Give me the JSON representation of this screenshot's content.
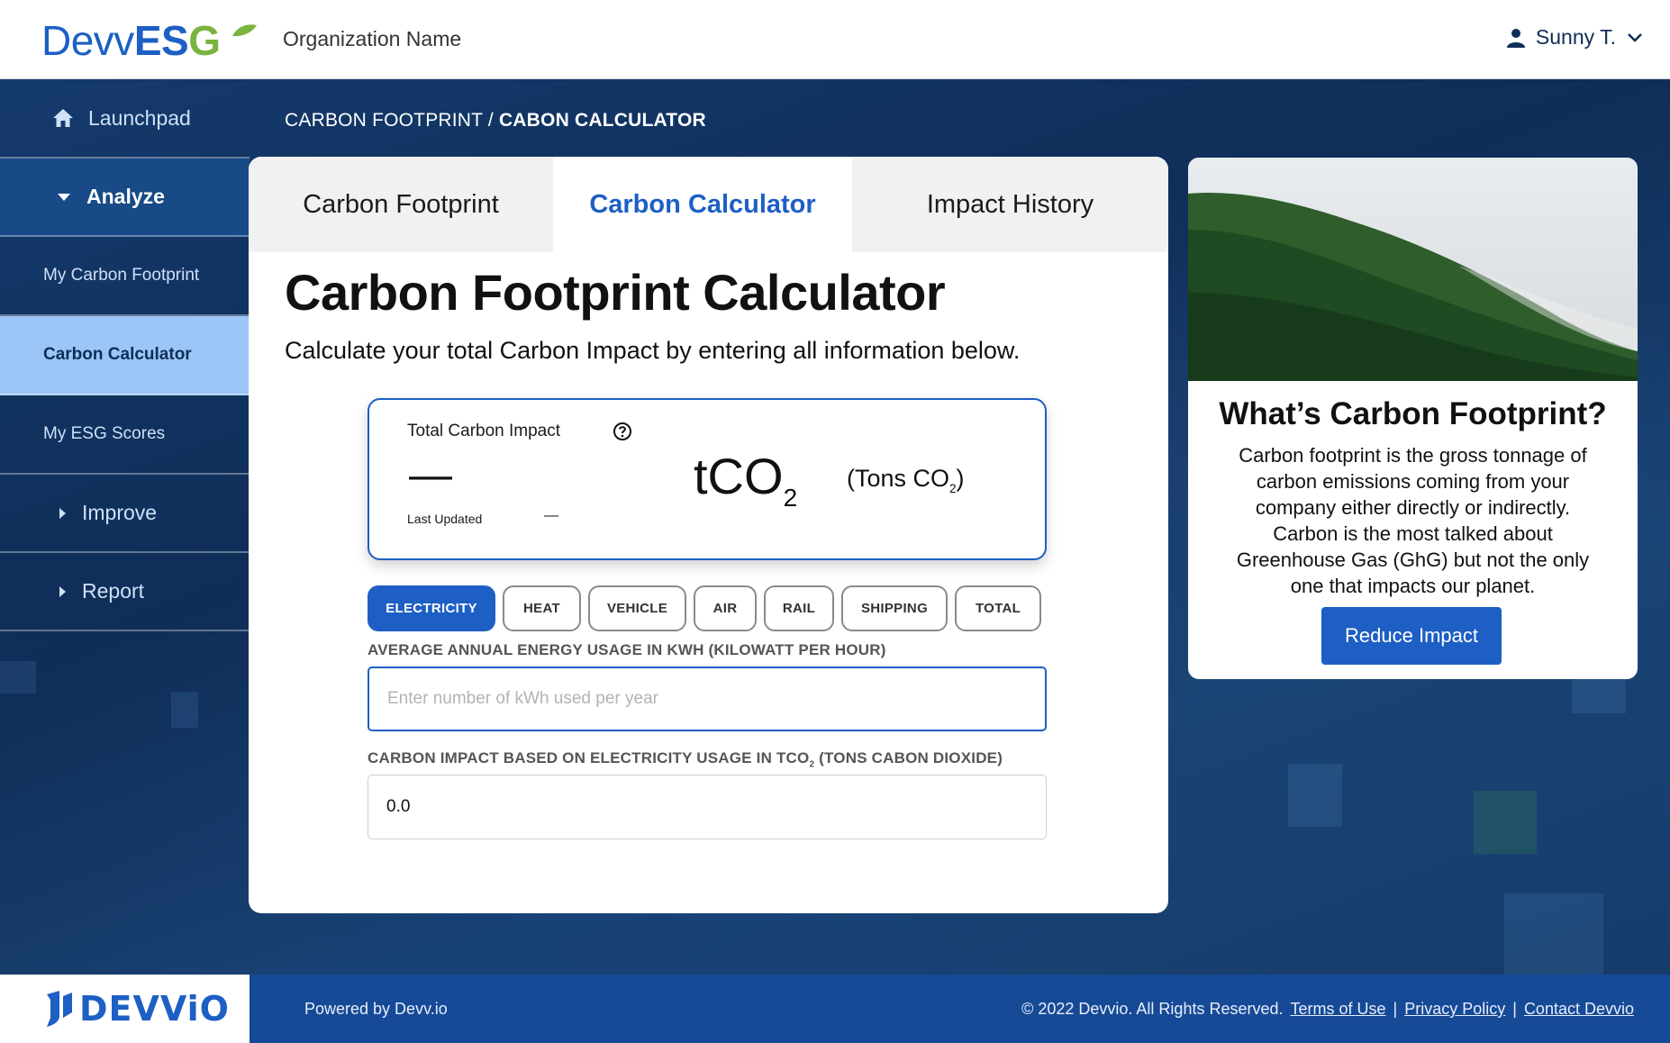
{
  "header": {
    "logo_devv": "Devv",
    "logo_esg": "ES",
    "logo_g": "G",
    "org_name": "Organization Name",
    "user_name": "Sunny T."
  },
  "sidebar": {
    "launchpad": "Launchpad",
    "analyze": "Analyze",
    "items": [
      {
        "label": "My Carbon Footprint"
      },
      {
        "label": "Carbon Calculator"
      },
      {
        "label": "My ESG Scores"
      }
    ],
    "improve": "Improve",
    "report": "Report"
  },
  "breadcrumb": {
    "parent": "CARBON FOOTPRINT",
    "separator": " / ",
    "current": "CABON CALCULATOR"
  },
  "tabs": [
    {
      "label": "Carbon Footprint"
    },
    {
      "label": "Carbon Calculator"
    },
    {
      "label": "Impact History"
    }
  ],
  "calculator": {
    "title": "Carbon Footprint Calculator",
    "subtitle": "Calculate your total Carbon Impact by entering all information below.",
    "impact_label": "Total Carbon Impact",
    "impact_value": "—",
    "last_updated_label": "Last Updated",
    "last_updated_value": "—",
    "unit_main": "tCO",
    "unit_sub": "2",
    "unit_desc_prefix": "(Tons CO",
    "unit_desc_sub": "2",
    "unit_desc_suffix": ")"
  },
  "categories": [
    "ELECTRICITY",
    "HEAT",
    "VEHICLE",
    "AIR",
    "RAIL",
    "SHIPPING",
    "TOTAL"
  ],
  "energy_field": {
    "label": "AVERAGE ANNUAL ENERGY USAGE IN KWH (KILOWATT PER HOUR)",
    "placeholder": "Enter number of kWh used per year",
    "value": ""
  },
  "impact_field": {
    "label_prefix": "CARBON IMPACT BASED ON ELECTRICITY USAGE IN TCO",
    "label_sub": "2",
    "label_suffix": " (TONS CABON DIOXIDE)",
    "value": "0.0"
  },
  "info_card": {
    "title": "What’s Carbon Footprint?",
    "text": "Carbon footprint is the gross tonnage of carbon emissions coming from your company either directly or indirectly. Carbon is the most talked about Greenhouse Gas (GhG) but not the only one that impacts our planet.",
    "button": "Reduce Impact"
  },
  "footer": {
    "logo_text": "DEVViO",
    "powered": "Powered by Devv.io",
    "copyright": "© 2022 Devvio. All Rights Reserved.",
    "links": [
      "Terms of Use",
      "Privacy Policy",
      "Contact Devvio"
    ],
    "divider": "|"
  },
  "colors": {
    "brand_blue": "#1d5fc4",
    "navy": "#0f2d57",
    "sidebar_active": "#9cc6f7",
    "leaf_green": "#7bb33f"
  }
}
